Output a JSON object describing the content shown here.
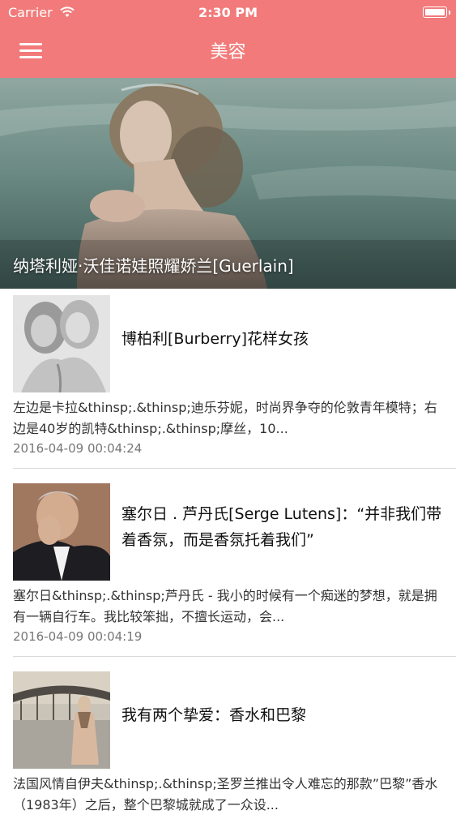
{
  "status_bar": {
    "carrier": "Carrier",
    "time": "2:30 PM"
  },
  "navbar": {
    "title": "美容",
    "menu_icon": "hamburger-menu-icon"
  },
  "hero": {
    "caption": "纳塔利娅·沃佳诺娃照耀娇兰[Guerlain]"
  },
  "articles": [
    {
      "title": "博柏利[Burberry]花样女孩",
      "summary": "左边是卡拉&thinsp;.&thinsp;迪乐芬妮，时尚界争夺的伦敦青年模特；右边是40岁的凯特&thinsp;.&thinsp;摩丝，10...",
      "date": "2016-04-09 00:04:24"
    },
    {
      "title": "塞尔日 . 芦丹氏[Serge Lutens]：“并非我们带着香氛，而是香氛托着我们”",
      "summary": "塞尔日&thinsp;.&thinsp;芦丹氏 - 我小的时候有一个痴迷的梦想，就是拥有一辆自行车。我比较笨拙，不擅长运动，会...",
      "date": "2016-04-09 00:04:19"
    },
    {
      "title": "我有两个挚爱：香水和巴黎",
      "summary": "法国风情自伊夫&thinsp;.&thinsp;圣罗兰推出令人难忘的那款”巴黎”香水（1983年）之后，整个巴黎城就成了一众设...",
      "date": ""
    }
  ],
  "colors": {
    "accent": "#f27a7a",
    "text": "#111111",
    "muted": "#777777"
  }
}
